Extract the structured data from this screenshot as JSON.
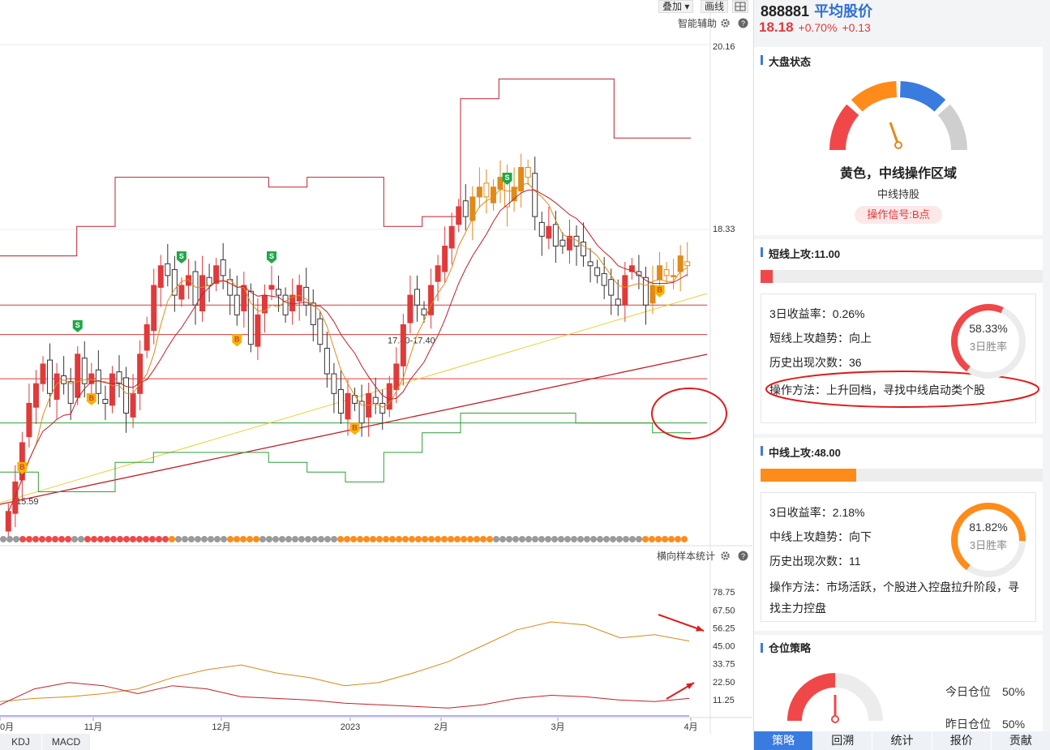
{
  "toolbar": {
    "overlay": "叠加 ▾",
    "draw": "画线"
  },
  "main_panel": {
    "title": "智能辅助",
    "price_label_high": "20.16",
    "price_label_mid": "18.33",
    "range_label": "17.40-17.40",
    "low_label": "15.59"
  },
  "sub_panel": {
    "title": "横向样本统计",
    "y_ticks": [
      "78.75",
      "67.50",
      "56.25",
      "45.00",
      "33.75",
      "22.50",
      "11.25"
    ]
  },
  "x_axis": {
    "labels": [
      "0月",
      "11月",
      "12月",
      "2023",
      "2月",
      "3月",
      "4月"
    ]
  },
  "indicator_tabs": [
    "KDJ",
    "MACD"
  ],
  "header": {
    "code": "888881",
    "name": "平均股价",
    "price": "18.18",
    "change_pct": "+0.70%",
    "change_val": "+0.13"
  },
  "market_state": {
    "title": "大盘状态",
    "headline": "黄色，中线操作区域",
    "subline": "中线持股",
    "signal": "操作信号:B点",
    "gauge_colors": [
      "#f04848",
      "#ff8c1a",
      "#3a7be0",
      "#cfcfcf"
    ]
  },
  "short_line": {
    "title": "短线上攻:11.00",
    "progress": 0.11,
    "color": "#f04848",
    "ret": "3日收益率：0.26%",
    "trend": "短线上攻趋势：向上",
    "count": "历史出现次数：36",
    "method": "操作方法：上升回档，寻找中线启动类个股",
    "win_pct": "58.33%",
    "win_label": "3日胜率",
    "win_value": 0.5833
  },
  "mid_line": {
    "title": "中线上攻:48.00",
    "progress": 0.48,
    "color": "#ff8c1a",
    "ret": "3日收益率：2.18%",
    "trend": "中线上攻趋势：向下",
    "count": "历史出现次数：11",
    "method_1": "操作方法：市场活跃，个股进入控盘拉升阶段，寻",
    "method_2": "找主力控盘",
    "win_pct": "81.82%",
    "win_label": "3日胜率",
    "win_value": 0.8182
  },
  "position": {
    "title": "仓位策略",
    "today": "今日仓位　50%",
    "yesterday": "昨日仓位　50%",
    "level": 0.5
  },
  "bottom_tabs": [
    "策略",
    "回溯",
    "统计",
    "报价",
    "贡献"
  ],
  "chart_data": {
    "type": "candlestick",
    "y_range": [
      15.4,
      20.35
    ],
    "horizontal_lines": [
      17.7,
      17.4,
      16.95,
      16.5
    ],
    "closes": [
      15.6,
      15.9,
      16.3,
      16.7,
      16.9,
      17.1,
      16.8,
      17.0,
      16.9,
      16.7,
      17.2,
      16.9,
      17.0,
      16.8,
      16.7,
      17.0,
      16.9,
      16.6,
      16.8,
      17.2,
      17.5,
      17.9,
      18.1,
      18.0,
      17.8,
      17.9,
      18.0,
      17.7,
      18.0,
      17.9,
      18.1,
      18.0,
      17.8,
      17.6,
      17.9,
      17.3,
      17.6,
      17.8,
      17.9,
      17.8,
      17.6,
      17.8,
      17.9,
      17.7,
      17.5,
      17.3,
      17.0,
      16.8,
      16.6,
      16.8,
      16.7,
      16.5,
      16.8,
      16.7,
      16.6,
      16.9,
      17.1,
      17.5,
      17.8,
      17.7,
      17.6,
      17.9,
      18.1,
      18.3,
      18.5,
      18.7,
      18.6,
      18.8,
      18.9,
      18.8,
      18.9,
      19.0,
      18.7,
      18.9,
      19.1,
      19.0,
      18.6,
      18.4,
      18.5,
      18.3,
      18.3,
      18.4,
      18.3,
      18.2,
      18.1,
      18.0,
      17.9,
      17.8,
      17.7,
      18.0,
      18.1,
      18.0,
      17.7,
      17.9,
      18.1,
      18.0,
      18.0,
      18.2,
      18.1
    ],
    "upper_band": [
      18.2,
      18.2,
      18.5,
      19.0,
      19.0,
      19.0,
      19.0,
      18.9,
      19.0,
      19.0,
      18.5,
      18.6,
      19.8,
      20.0,
      20.0,
      20.0,
      19.4,
      19.4
    ],
    "lower_band": [
      16.0,
      15.8,
      15.8,
      16.1,
      16.2,
      16.2,
      16.2,
      16.1,
      16.0,
      15.9,
      16.2,
      16.4,
      16.6,
      16.6,
      16.6,
      16.5,
      16.5,
      16.4
    ],
    "sub_series": [
      {
        "name": "橙线",
        "values": [
          10,
          12,
          13,
          15,
          18,
          25,
          30,
          33,
          28,
          25,
          20,
          22,
          28,
          35,
          45,
          55,
          60,
          58,
          50,
          52,
          48
        ]
      },
      {
        "name": "红线",
        "values": [
          8,
          18,
          22,
          20,
          15,
          20,
          18,
          13,
          12,
          11,
          9,
          8,
          7,
          6,
          8,
          12,
          14,
          13,
          11,
          10,
          12
        ]
      }
    ]
  }
}
